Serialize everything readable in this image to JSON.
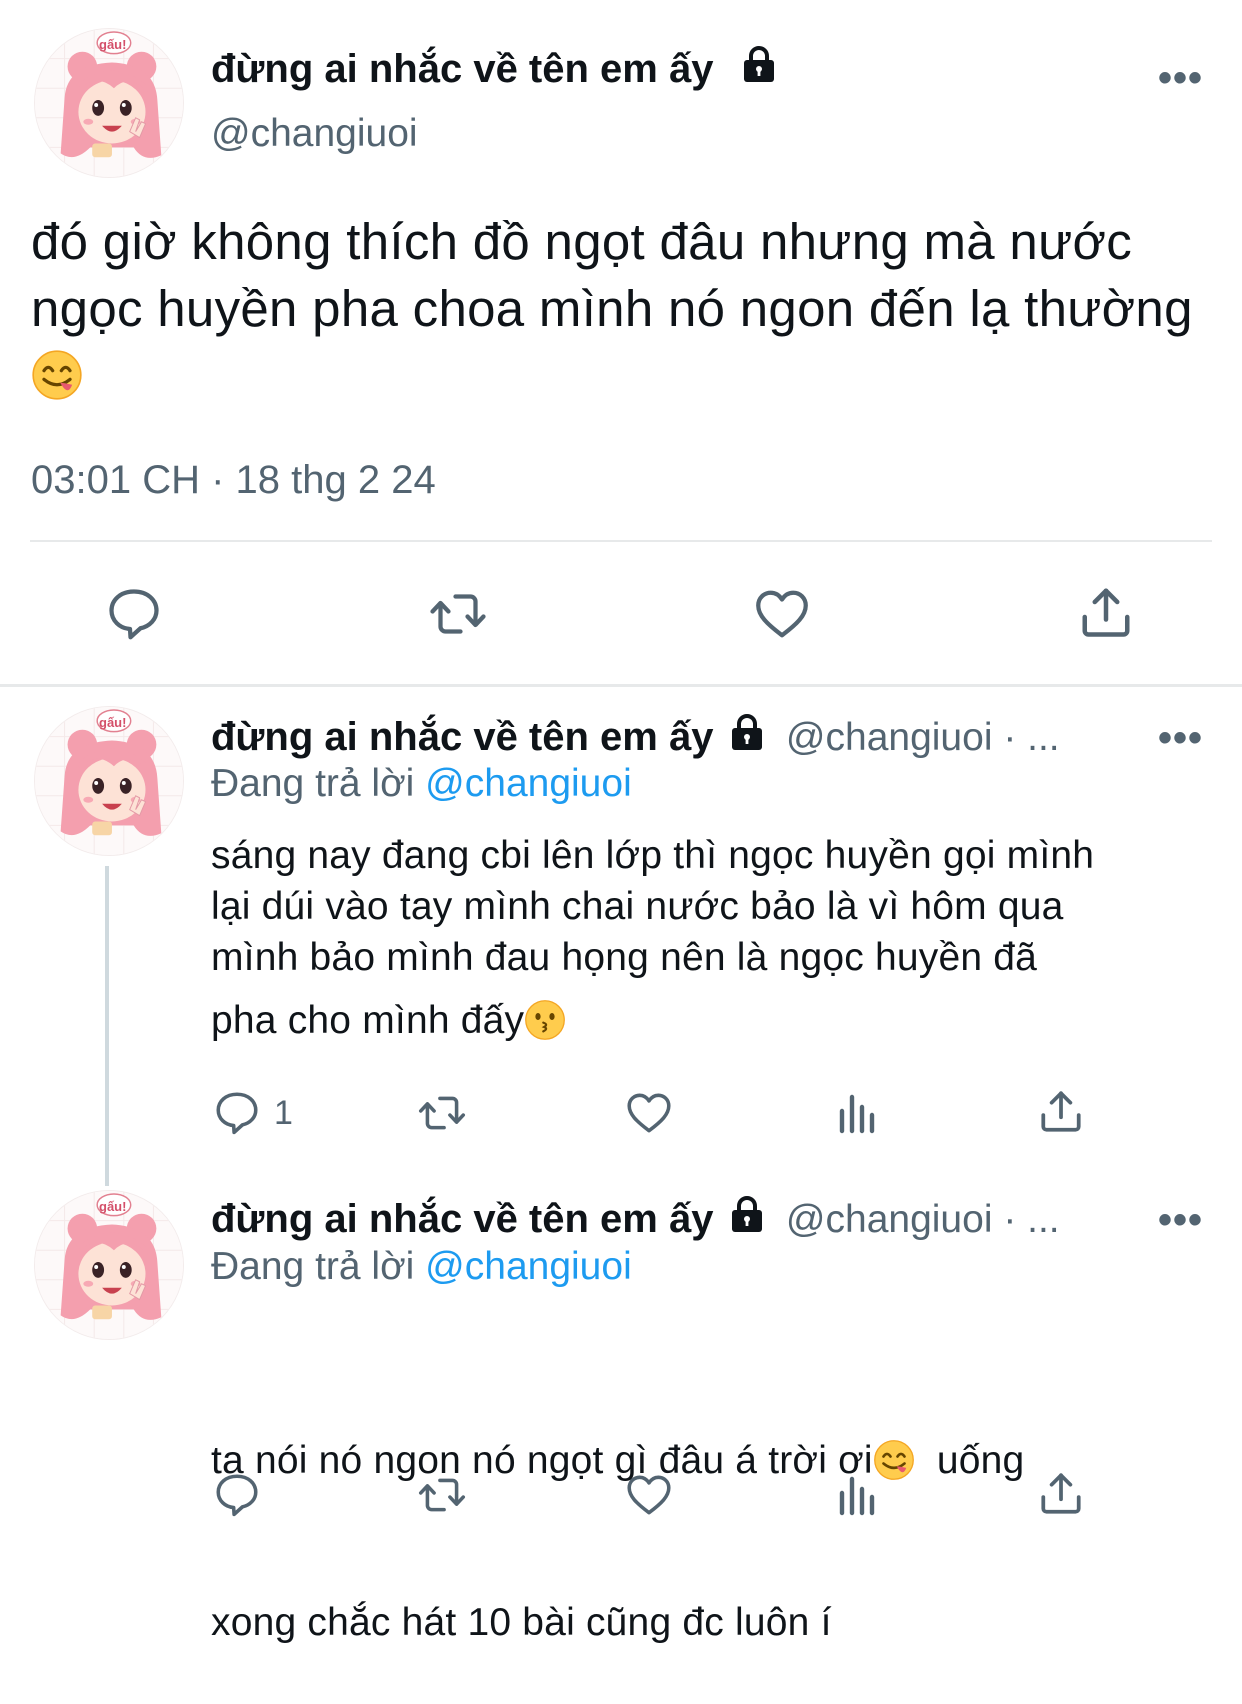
{
  "main_tweet": {
    "display_name": "đừng ai nhắc về tên em ấy",
    "handle": "@changiuoi",
    "text": "đó giờ không thích đồ ngọt đâu nhưng mà nước ngọc huyền pha choa mình nó ngon đến lạ thường",
    "timestamp": "03:01 CH · 18 thg 2 24",
    "avatar_sticker_text": "gấu!"
  },
  "replies": [
    {
      "display_name": "đừng ai nhắc về tên em ấy",
      "handle_trunc": "@changiuoi · ...",
      "replying_label": "Đang trả lời",
      "replying_to": "@changiuoi",
      "text_lines": [
        "sáng nay đang cbi lên lớp thì ngọc huyền gọi mình",
        "lại dúi vào tay mình chai nước bảo là vì hôm qua",
        "mình bảo mình đau họng nên là ngọc huyền đã",
        "pha cho mình đấy"
      ],
      "reply_count": "1",
      "avatar_sticker_text": "gấu!"
    },
    {
      "display_name": "đừng ai nhắc về tên em ấy",
      "handle_trunc": "@changiuoi · ...",
      "replying_label": "Đang trả lời",
      "replying_to": "@changiuoi",
      "text_lines": [
        "ta nói nó ngon nó ngọt gì đâu á trời ơi",
        "  uống",
        "xong chắc hát 10 bài cũng đc luôn í"
      ],
      "reply_count": "",
      "avatar_sticker_text": "gấu!"
    }
  ],
  "more_label": "•••",
  "icons": {
    "reply": "speech-bubble-icon",
    "retweet": "retweet-arrows-icon",
    "like": "heart-icon",
    "views": "bar-chart-icon",
    "share": "share-upload-icon",
    "lock": "lock-icon",
    "emoji_yum": "face-savoring-food-emoji",
    "emoji_kiss": "kissing-face-emoji"
  },
  "colors": {
    "text": "#0f1419",
    "muted": "#536471",
    "link": "#1d9bf0",
    "divider": "#e7e9ea"
  }
}
